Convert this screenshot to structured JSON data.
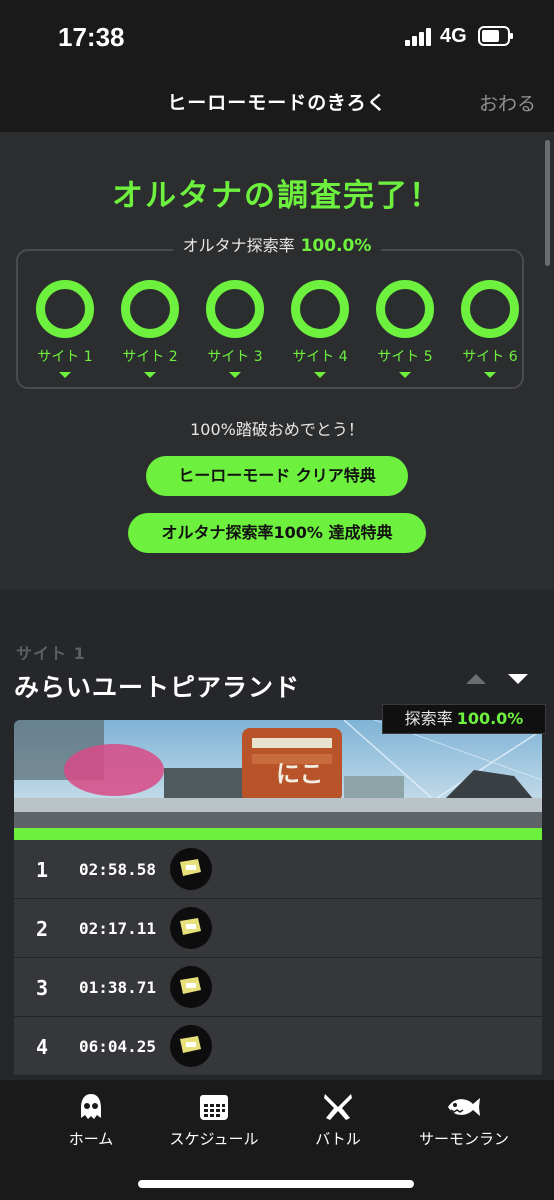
{
  "status_bar": {
    "time": "17:38",
    "network": "4G"
  },
  "header": {
    "title": "ヒーローモードのきろく",
    "close_label": "おわる"
  },
  "summary": {
    "complete_title": "オルタナの調査完了！",
    "rate_label": "オルタナ探索率",
    "rate_value": "100.0%",
    "sites": [
      {
        "label": "サイト 1",
        "progress": 1.0
      },
      {
        "label": "サイト 2",
        "progress": 1.0
      },
      {
        "label": "サイト 3",
        "progress": 1.0
      },
      {
        "label": "サイト 4",
        "progress": 1.0
      },
      {
        "label": "サイト 5",
        "progress": 1.0
      },
      {
        "label": "サイト 6",
        "progress": 1.0
      }
    ],
    "congrats_text": "100%踏破おめでとう！",
    "reward_button_1": "ヒーローモード クリア特典",
    "reward_button_2": "オルタナ探索率100% 達成特典"
  },
  "site_detail": {
    "site_number": "サイト 1",
    "site_name": "みらいユートピアランド",
    "rate_label": "探索率",
    "rate_value": "100.0%",
    "image_sign": "にこ",
    "records": [
      {
        "number": "1",
        "time": "02:58.58"
      },
      {
        "number": "2",
        "time": "02:17.11"
      },
      {
        "number": "3",
        "time": "01:38.71"
      },
      {
        "number": "4",
        "time": "06:04.25"
      }
    ]
  },
  "tabs": [
    {
      "label": "ホーム",
      "icon": "squid-icon"
    },
    {
      "label": "スケジュール",
      "icon": "calendar-icon"
    },
    {
      "label": "バトル",
      "icon": "battle-icon"
    },
    {
      "label": "サーモンラン",
      "icon": "salmon-icon"
    }
  ],
  "colors": {
    "accent": "#6df13e",
    "background": "#1c1c1e",
    "panel": "#2c2d2f"
  }
}
